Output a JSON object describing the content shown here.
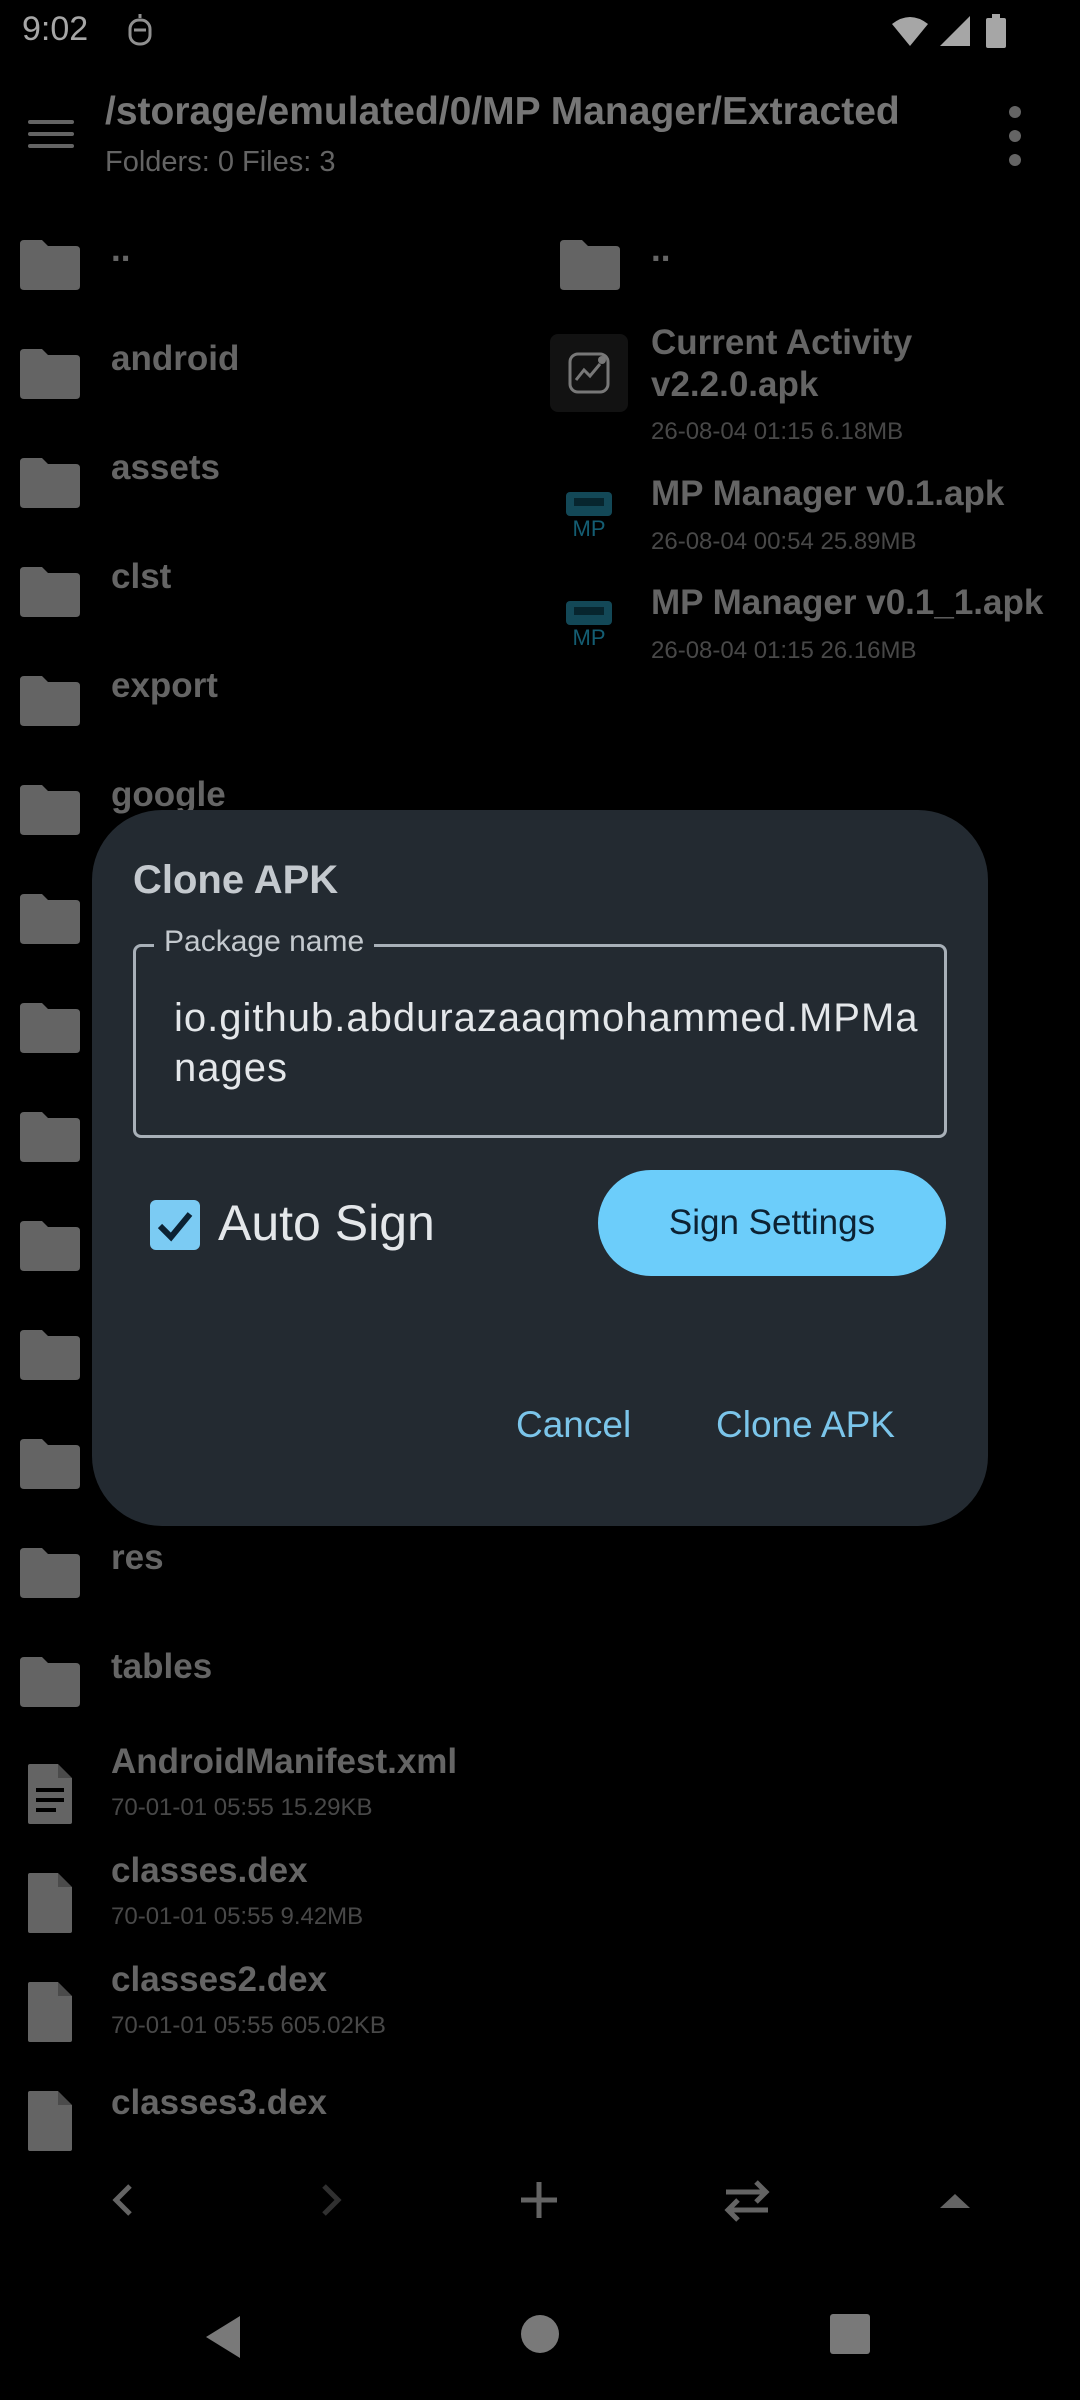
{
  "status_bar": {
    "time": "9:02"
  },
  "header": {
    "path": "/storage/emulated/0/MP Manager/Extracted",
    "summary": "Folders: 0 Files: 3"
  },
  "left_list": [
    {
      "name": "..",
      "type": "folder",
      "meta": ""
    },
    {
      "name": "android",
      "type": "folder",
      "meta": ""
    },
    {
      "name": "assets",
      "type": "folder",
      "meta": ""
    },
    {
      "name": "clst",
      "type": "folder",
      "meta": ""
    },
    {
      "name": "export",
      "type": "folder",
      "meta": ""
    },
    {
      "name": "google",
      "type": "folder",
      "meta": ""
    },
    {
      "name": "",
      "type": "folder",
      "meta": ""
    },
    {
      "name": "",
      "type": "folder",
      "meta": ""
    },
    {
      "name": "",
      "type": "folder",
      "meta": ""
    },
    {
      "name": "",
      "type": "folder",
      "meta": ""
    },
    {
      "name": "",
      "type": "folder",
      "meta": ""
    },
    {
      "name": "",
      "type": "folder",
      "meta": ""
    },
    {
      "name": "res",
      "type": "folder",
      "meta": ""
    },
    {
      "name": "tables",
      "type": "folder",
      "meta": ""
    },
    {
      "name": "AndroidManifest.xml",
      "type": "text-file",
      "meta": "70-01-01 05:55 15.29KB"
    },
    {
      "name": "classes.dex",
      "type": "file",
      "meta": "70-01-01 05:55 9.42MB"
    },
    {
      "name": "classes2.dex",
      "type": "file",
      "meta": "70-01-01 05:55 605.02KB"
    },
    {
      "name": "classes3.dex",
      "type": "file",
      "meta": ""
    }
  ],
  "right_list": [
    {
      "name": "..",
      "type": "folder",
      "meta": ""
    },
    {
      "name": "Current Activity v2.2.0.apk",
      "type": "apk-activity",
      "meta": "26-08-04 01:15 6.18MB"
    },
    {
      "name": "MP Manager v0.1.apk",
      "type": "apk-mp",
      "meta": "26-08-04 00:54 25.89MB"
    },
    {
      "name": "MP Manager v0.1_1.apk",
      "type": "apk-mp",
      "meta": "26-08-04 01:15 26.16MB"
    }
  ],
  "dialog": {
    "title": "Clone APK",
    "field_label": "Package name",
    "field_value": "io.github.abdurazaaqmohammed.MPManages",
    "checkbox_label": "Auto Sign",
    "checkbox_checked": true,
    "sign_settings_label": "Sign Settings",
    "cancel_label": "Cancel",
    "confirm_label": "Clone APK"
  },
  "colors": {
    "accent": "#6ccdfa",
    "dialog_bg": "#232a31",
    "background": "#000000"
  }
}
